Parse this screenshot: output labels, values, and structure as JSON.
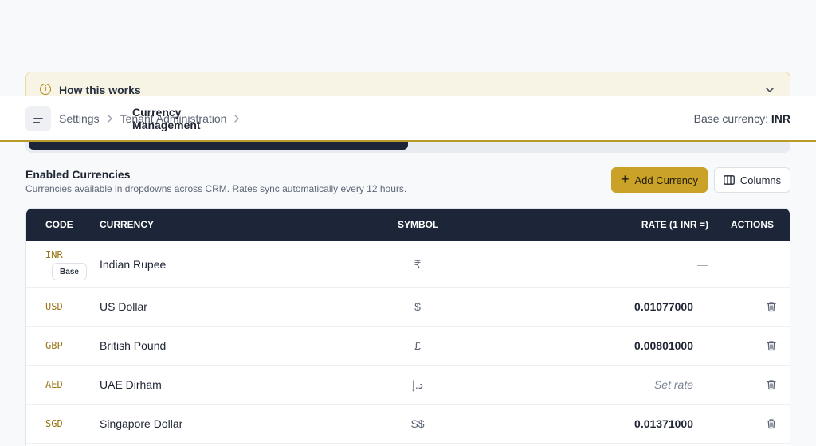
{
  "info_banner": {
    "title": "How this works"
  },
  "header": {
    "breadcrumbs": [
      "Settings",
      "Tenant Administration",
      "Currency Management"
    ],
    "base_label": "Base currency:",
    "base_code": "INR"
  },
  "section": {
    "title": "Enabled Currencies",
    "subtitle": "Currencies available in dropdowns across CRM. Rates sync automatically every 12 hours.",
    "add_label": "Add Currency",
    "columns_label": "Columns"
  },
  "table": {
    "headers": {
      "code": "CODE",
      "currency": "CURRENCY",
      "symbol": "SYMBOL",
      "rate": "RATE (1 INR =)",
      "actions": "ACTIONS"
    },
    "base_badge": "Base",
    "rows": [
      {
        "code": "INR",
        "currency": "Indian Rupee",
        "symbol": "₹",
        "rate": "—"
      },
      {
        "code": "USD",
        "currency": "US Dollar",
        "symbol": "$",
        "rate": "0.01077000"
      },
      {
        "code": "GBP",
        "currency": "British Pound",
        "symbol": "£",
        "rate": "0.00801000"
      },
      {
        "code": "AED",
        "currency": "UAE Dirham",
        "symbol": "د.إ",
        "rate": "Set rate"
      },
      {
        "code": "SGD",
        "currency": "Singapore Dollar",
        "symbol": "S$",
        "rate": "0.01371000"
      }
    ]
  },
  "colors": {
    "accent": "#c9a227",
    "header_dark": "#1d2638",
    "code_text": "#9a7418"
  }
}
